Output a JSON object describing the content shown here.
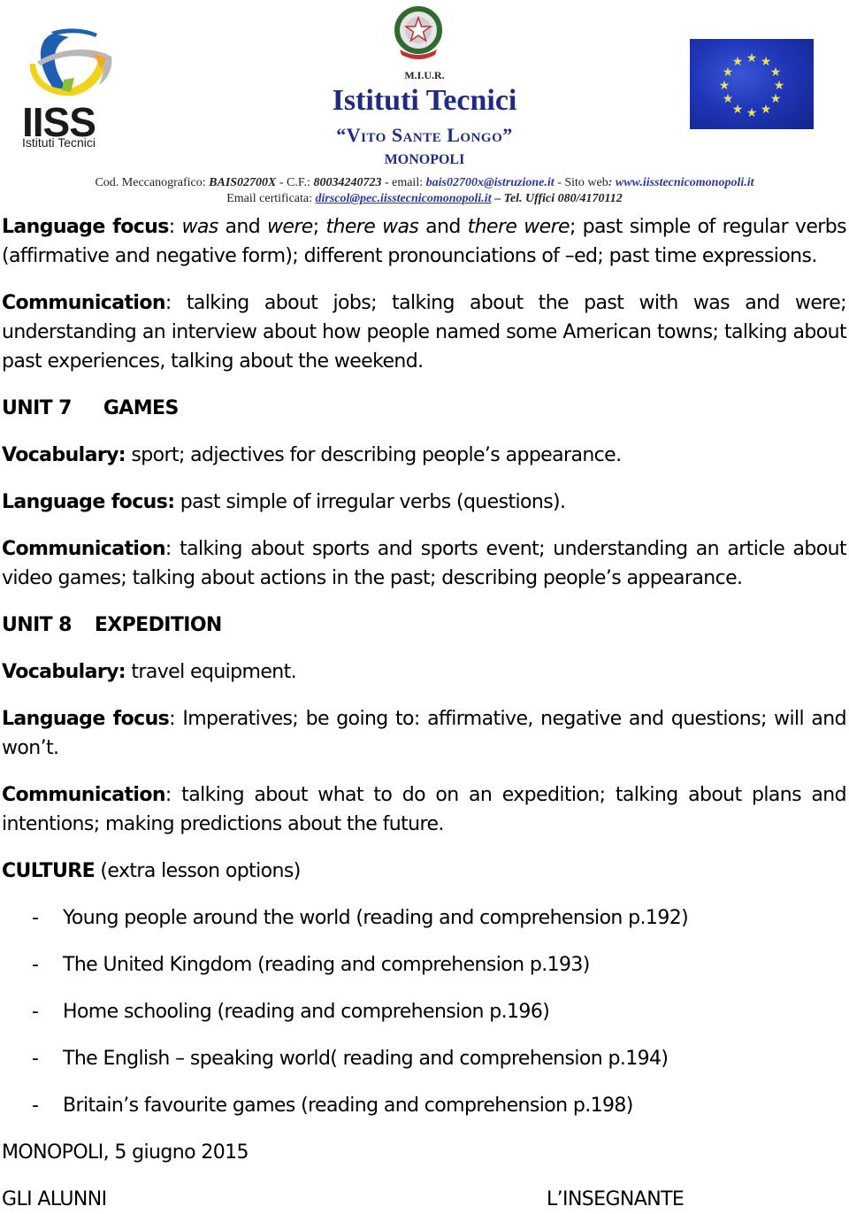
{
  "header": {
    "left_logo": {
      "name": "IISS",
      "subtitle": "Istituti Tecnici",
      "colors": [
        "#1d5fb0",
        "#f2d21c",
        "#b8b8b8",
        "#f3a81b",
        "#8bbf3a"
      ]
    },
    "center": {
      "ministry": "M.I.U.R.",
      "title": "Istituti Tecnici",
      "school_name": "“Vito Sante Longo”",
      "city": "MONOPOLI",
      "title_color": "#1f2a85"
    },
    "right_logo": {
      "name": "EU flag",
      "color": "#1f36b8",
      "star_color": "#e8e060"
    },
    "contact_line1": {
      "cod_label": "Cod. Meccanografico: ",
      "cod_value": "BAIS02700X",
      "cf_label": " - C.F.: ",
      "cf_value": "80034240723",
      "email_label": " - email: ",
      "email_value": "bais02700x@istruzione.it",
      "web_label": " -  Sito web",
      "web_value": ": www.iisstecnicomonopoli.it"
    },
    "contact_line2": {
      "pec_label": "Email certificata: ",
      "pec_value": "dirscol@pec.iisstecnicomonopoli.it",
      "tel": " – Tel. Uffici 080/4170112"
    }
  },
  "content": {
    "lf6": {
      "label": "Language focus",
      "colon": ": ",
      "w1": "was",
      "t1": " and ",
      "w2": "were",
      "t2": "; ",
      "w3": "there was",
      "t3": " and ",
      "w4": "there were",
      "t4": "; past simple of regular verbs (affirmative and negative form); different pronounciations of –ed; past time expressions."
    },
    "comm6": {
      "label": "Communication",
      "text": ": talking about jobs; talking about the past with was and were; understanding an interview about how people named some American towns; talking about past experiences, talking about the weekend."
    },
    "unit7": {
      "number": "UNIT  7",
      "title": "GAMES",
      "vocab_label": "Vocabulary:",
      "vocab_text": " sport; adjectives for describing people’s appearance.",
      "lf_label": "Language focus:",
      "lf_text": " past simple of irregular verbs (questions).",
      "comm_label": "Communication",
      "comm_text": ": talking about sports and sports event; understanding an article about video games; talking about actions in the past; describing people’s appearance."
    },
    "unit8": {
      "number": "UNIT 8",
      "title": "EXPEDITION",
      "vocab_label": "Vocabulary:",
      "vocab_text": " travel equipment.",
      "lf_label": "Language focus",
      "lf_text": ": Imperatives; be going to: affirmative, negative and questions; will and won’t.",
      "comm_label": "Communication",
      "comm_text": ": talking about what to do on an expedition; talking about plans and intentions; making predictions about the future."
    },
    "culture": {
      "label": "CULTURE",
      "note": " (extra lesson options)",
      "bullet": "-",
      "items": [
        "Young people around the world (reading and comprehension p.192)",
        "The United Kingdom (reading and comprehension p.193)",
        "Home schooling (reading and comprehension p.196)",
        "The English – speaking world( reading and comprehension p.194)",
        "Britain’s favourite games (reading and comprehension p.198)"
      ]
    },
    "date": "MONOPOLI, 5 giugno 2015",
    "signature_left": "GLI ALUNNI",
    "signature_right": "L’INSEGNANTE"
  }
}
